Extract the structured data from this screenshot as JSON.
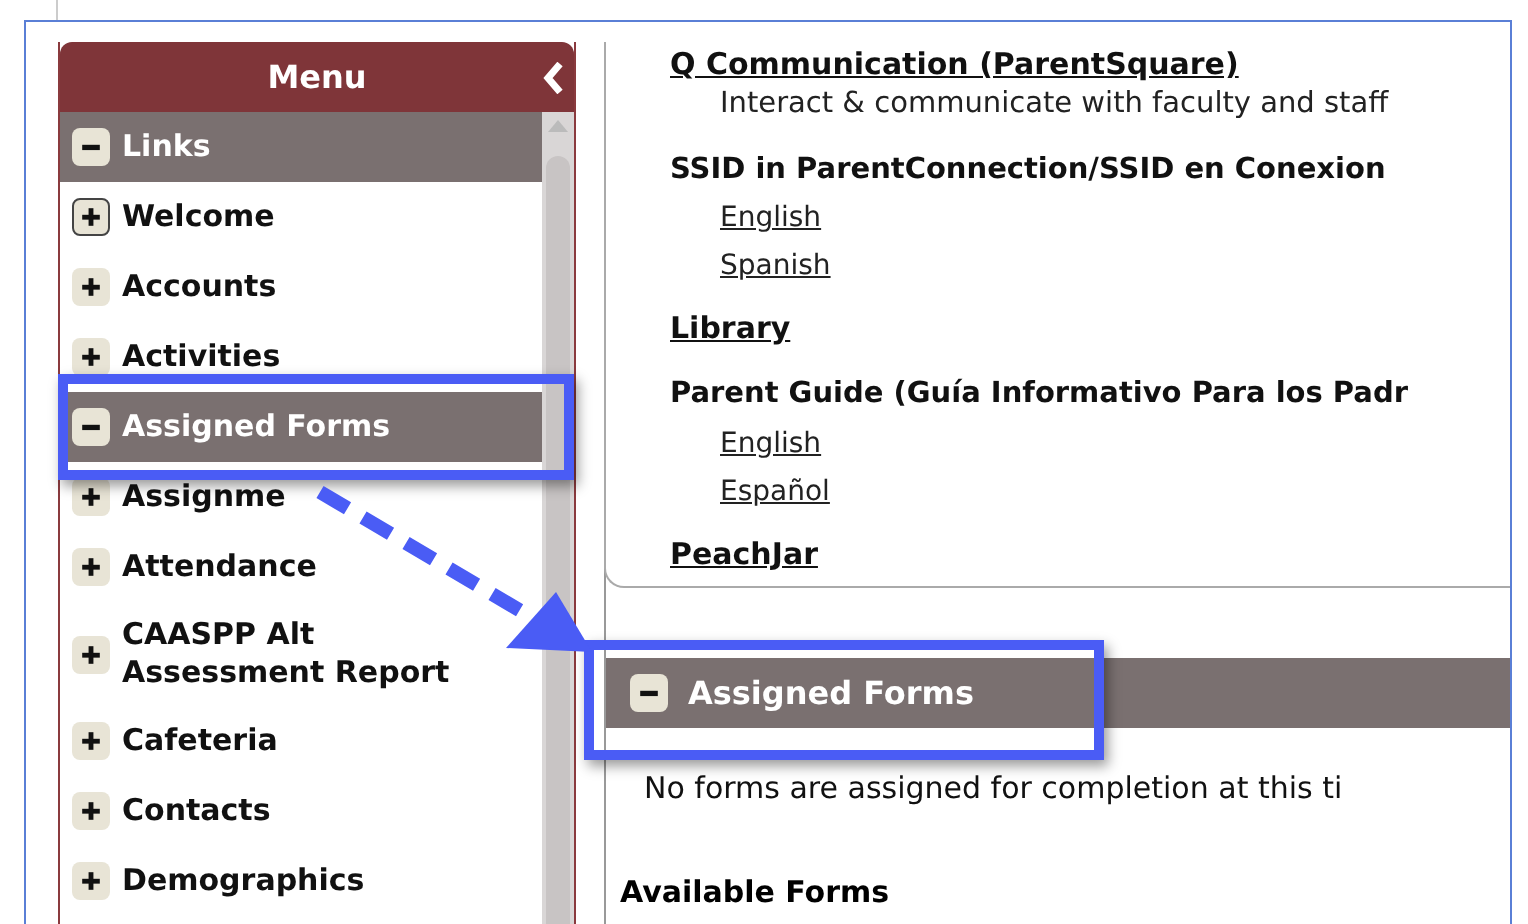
{
  "menu": {
    "title": "Menu"
  },
  "menu_items": [
    {
      "label": "Links",
      "expanded": true,
      "focused": false
    },
    {
      "label": "Welcome",
      "expanded": false,
      "focused": true
    },
    {
      "label": "Accounts",
      "expanded": false,
      "focused": false
    },
    {
      "label": "Activities",
      "expanded": false,
      "focused": false
    },
    {
      "label": "Assigned Forms",
      "expanded": true,
      "focused": false
    },
    {
      "label": "Assignme",
      "expanded": false,
      "focused": false
    },
    {
      "label": "Attendance",
      "expanded": false,
      "focused": false
    },
    {
      "label": "CAASPP Alt Assessment Report",
      "expanded": false,
      "focused": false
    },
    {
      "label": "Cafeteria",
      "expanded": false,
      "focused": false
    },
    {
      "label": "Contacts",
      "expanded": false,
      "focused": false
    },
    {
      "label": "Demographics",
      "expanded": false,
      "focused": false
    }
  ],
  "links": [
    {
      "kind": "link",
      "text": "Q Communication (ParentSquare)"
    },
    {
      "kind": "description",
      "text": "Interact & communicate with faculty and staff"
    },
    {
      "kind": "heading",
      "text": "SSID in ParentConnection/SSID en Conexion"
    },
    {
      "kind": "sublink",
      "text": "English"
    },
    {
      "kind": "sublink",
      "text": "Spanish"
    },
    {
      "kind": "link",
      "text": "Library"
    },
    {
      "kind": "heading",
      "text": "Parent Guide (Guía Informativo Para los Padr"
    },
    {
      "kind": "sublink",
      "text": "English"
    },
    {
      "kind": "sublink",
      "text": "Español"
    },
    {
      "kind": "link",
      "text": "PeachJar"
    }
  ],
  "assigned_forms": {
    "title": "Assigned Forms",
    "expanded": true,
    "message": "No forms are assigned for completion at this ti"
  },
  "available_forms": {
    "title": "Available Forms"
  }
}
